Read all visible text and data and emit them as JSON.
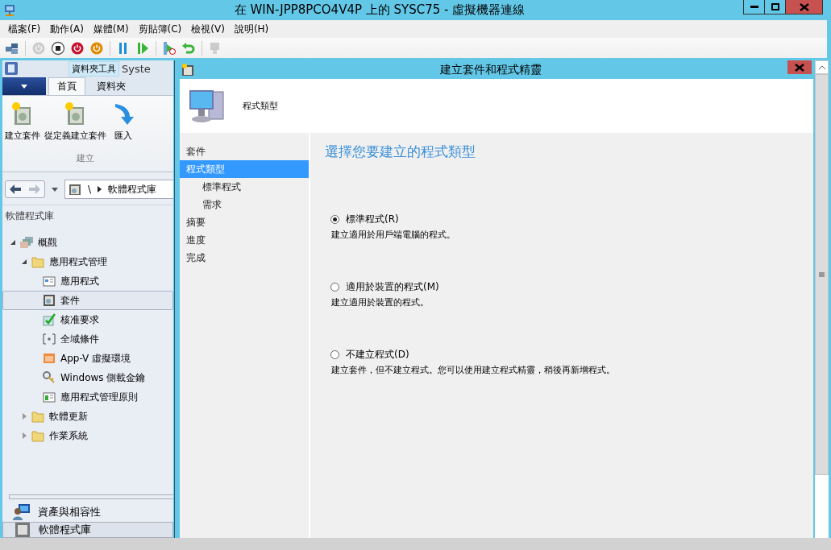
{
  "window": {
    "title": "在 WIN-JPP8PCO4V4P 上的 SYSC75 - 虛擬機器連線"
  },
  "menu": [
    "檔案(F)",
    "動作(A)",
    "媒體(M)",
    "剪貼簿(C)",
    "檢視(V)",
    "說明(H)"
  ],
  "toolbar": [
    {
      "kind": "keys",
      "disabled": false
    },
    {
      "kind": "separator"
    },
    {
      "kind": "start",
      "disabled": true
    },
    {
      "kind": "turn-off",
      "disabled": false
    },
    {
      "kind": "shut-down",
      "disabled": false
    },
    {
      "kind": "save",
      "disabled": false
    },
    {
      "kind": "separator"
    },
    {
      "kind": "pause",
      "disabled": false
    },
    {
      "kind": "resume",
      "disabled": false
    },
    {
      "kind": "separator"
    },
    {
      "kind": "checkpoint",
      "disabled": false
    },
    {
      "kind": "revert",
      "disabled": false
    },
    {
      "kind": "separator"
    },
    {
      "kind": "enhanced",
      "disabled": true
    }
  ],
  "console": {
    "context_tab": "資料夾工具",
    "title": "Syste",
    "ribbon_tabs": [
      {
        "label": "首頁",
        "selected": true
      },
      {
        "label": "資料夾",
        "selected": false
      }
    ],
    "ribbon_buttons": [
      {
        "kind": "package-new",
        "label": "建立套件"
      },
      {
        "kind": "package-new",
        "label": "從定義建立套件"
      },
      {
        "kind": "import",
        "label": "匯入"
      }
    ],
    "ribbon_group": "建立",
    "breadcrumb": [
      "\\",
      "軟體程式庫"
    ],
    "section_title": "軟體程式庫",
    "tree": [
      {
        "kind": "overview",
        "label": "概觀",
        "expanded": true,
        "selected": false,
        "children": [
          {
            "kind": "folder",
            "label": "應用程式管理",
            "expanded": true,
            "selected": false,
            "children": [
              {
                "kind": "application",
                "label": "應用程式",
                "selected": false
              },
              {
                "kind": "package",
                "label": "套件",
                "selected": true
              },
              {
                "kind": "approval",
                "label": "核准要求",
                "selected": false
              },
              {
                "kind": "condition",
                "label": "全域條件",
                "selected": false
              },
              {
                "kind": "appv",
                "label": "App-V 虛擬環境",
                "selected": false
              },
              {
                "kind": "key",
                "label": "Windows 側載金鑰",
                "selected": false
              },
              {
                "kind": "policy",
                "label": "應用程式管理原則",
                "selected": false
              }
            ]
          },
          {
            "kind": "folder",
            "label": "軟體更新",
            "expanded": false,
            "selected": false
          },
          {
            "kind": "folder",
            "label": "作業系統",
            "expanded": false,
            "selected": false
          }
        ]
      }
    ],
    "workspaces": [
      {
        "kind": "assets",
        "label": "資產與相容性"
      },
      {
        "kind": "library",
        "label": "軟體程式庫"
      }
    ]
  },
  "wizard": {
    "title": "建立套件和程式精靈",
    "header": "程式類型",
    "steps": [
      {
        "label": "套件",
        "selected": false
      },
      {
        "label": "程式類型",
        "selected": true,
        "children": [
          {
            "label": "標準程式",
            "selected": false
          },
          {
            "label": "需求",
            "selected": false
          }
        ]
      },
      {
        "label": "摘要",
        "selected": false
      },
      {
        "label": "進度",
        "selected": false
      },
      {
        "label": "完成",
        "selected": false
      }
    ],
    "heading": "選擇您要建立的程式類型",
    "options": [
      {
        "label": "標準程式(R)",
        "description": "建立適用於用戶端電腦的程式。",
        "selected": true
      },
      {
        "label": "適用於裝置的程式(M)",
        "description": "建立適用於裝置的程式。",
        "selected": false
      },
      {
        "label": "不建立程式(D)",
        "description": "建立套件，但不建立程式。您可以使用建立程式精靈，稍後再新增程式。",
        "selected": false
      }
    ]
  }
}
